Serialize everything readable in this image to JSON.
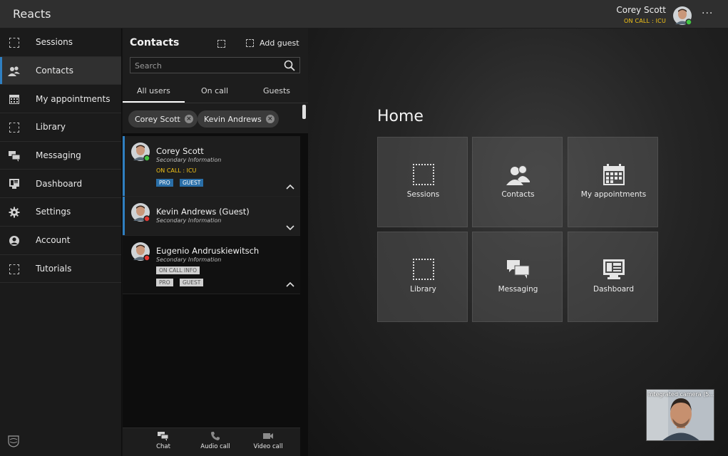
{
  "topbar": {
    "app_title": "Reacts",
    "user_name": "Corey Scott",
    "user_status": "ON CALL : ICU",
    "more_label": "···"
  },
  "sidebar": {
    "items": [
      {
        "label": "Sessions",
        "icon": "dashed-square-icon"
      },
      {
        "label": "Contacts",
        "icon": "contacts-icon"
      },
      {
        "label": "My appointments",
        "icon": "calendar-icon"
      },
      {
        "label": "Library",
        "icon": "dashed-square-icon"
      },
      {
        "label": "Messaging",
        "icon": "chat-bubbles-icon"
      },
      {
        "label": "Dashboard",
        "icon": "dashboard-icon"
      },
      {
        "label": "Settings",
        "icon": "gear-icon"
      },
      {
        "label": "Account",
        "icon": "account-icon"
      },
      {
        "label": "Tutorials",
        "icon": "dashed-square-icon"
      }
    ],
    "active": "Contacts"
  },
  "contacts": {
    "title": "Contacts",
    "add_guest_label": "Add guest",
    "search_placeholder": "Search",
    "tabs": [
      "All users",
      "On call",
      "Guests"
    ],
    "active_tab": "All users",
    "chips": [
      "Corey Scott",
      "Kevin Andrews"
    ],
    "chip_remove": "×",
    "list": [
      {
        "name": "Corey Scott",
        "secondary": "Secondary Information",
        "status": "ON CALL : ICU",
        "badges": [
          "PRO",
          "GUEST"
        ],
        "presence": "online"
      },
      {
        "name": "Kevin Andrews (Guest)",
        "secondary": "Secondary Information",
        "presence": "busy"
      },
      {
        "name": "Eugenio Andruskiewitsch",
        "secondary": "Secondary Information",
        "status_badge": "ON CALL INFO",
        "badges": [
          "PRO",
          "GUEST"
        ],
        "presence": "busy"
      }
    ],
    "footer": [
      "Chat",
      "Audio call",
      "Video call"
    ]
  },
  "main": {
    "title": "Home",
    "tiles": [
      {
        "label": "Sessions",
        "icon": "dashed-square-icon"
      },
      {
        "label": "Contacts",
        "icon": "contacts-icon"
      },
      {
        "label": "My appointments",
        "icon": "calendar-icon"
      },
      {
        "label": "Library",
        "icon": "dashed-square-icon"
      },
      {
        "label": "Messaging",
        "icon": "chat-bubbles-icon"
      },
      {
        "label": "Dashboard",
        "icon": "dashboard-icon"
      }
    ]
  },
  "camera": {
    "label": "Integrated camera (5..."
  },
  "colors": {
    "accent": "#2f7fc1",
    "status_yellow": "#f5c518",
    "online": "#44c743",
    "busy": "#e53935"
  }
}
